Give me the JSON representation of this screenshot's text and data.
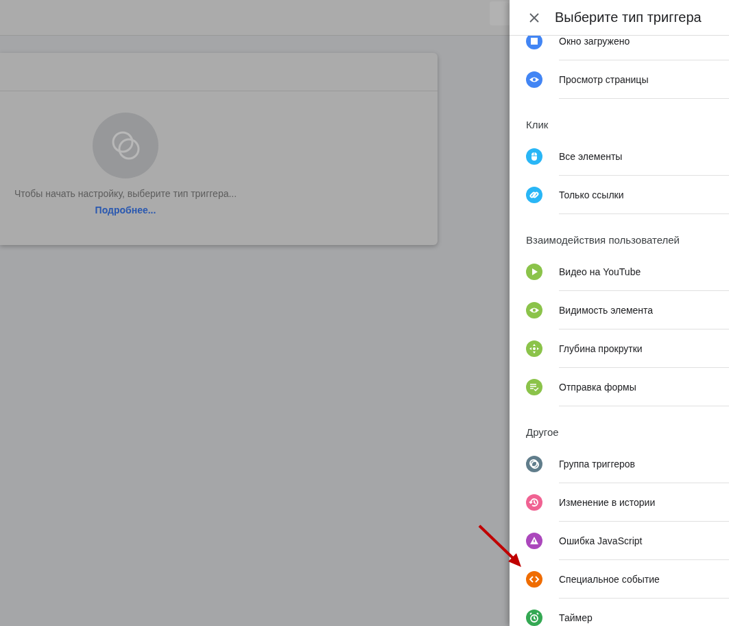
{
  "background_card": {
    "message": "Чтобы начать настройку, выберите тип триггера...",
    "link": "Подробнее..."
  },
  "drawer": {
    "title": "Выберите тип триггера",
    "sections": [
      {
        "items": [
          {
            "label": "Окно загружено",
            "kind": "window",
            "color": "#4285f4"
          },
          {
            "label": "Просмотр страницы",
            "kind": "eye",
            "color": "#4285f4"
          }
        ]
      },
      {
        "heading": "Клик",
        "items": [
          {
            "label": "Все элементы",
            "kind": "mouse",
            "color": "#29b6f6"
          },
          {
            "label": "Только ссылки",
            "kind": "link",
            "color": "#29b6f6"
          }
        ]
      },
      {
        "heading": "Взаимодействия пользователей",
        "items": [
          {
            "label": "Видео на YouTube",
            "kind": "play",
            "color": "#8bc34a"
          },
          {
            "label": "Видимость элемента",
            "kind": "eye",
            "color": "#8bc34a"
          },
          {
            "label": "Глубина прокрутки",
            "kind": "move",
            "color": "#8bc34a"
          },
          {
            "label": "Отправка формы",
            "kind": "form",
            "color": "#8bc34a"
          }
        ]
      },
      {
        "heading": "Другое",
        "items": [
          {
            "label": "Группа триггеров",
            "kind": "group",
            "color": "#607d8b"
          },
          {
            "label": "Изменение в истории",
            "kind": "history",
            "color": "#f06292"
          },
          {
            "label": "Ошибка JavaScript",
            "kind": "warning",
            "color": "#ab47bc"
          },
          {
            "label": "Специальное событие",
            "kind": "code",
            "color": "#ef6c00"
          },
          {
            "label": "Таймер",
            "kind": "alarm",
            "color": "#34a853"
          }
        ]
      }
    ]
  }
}
